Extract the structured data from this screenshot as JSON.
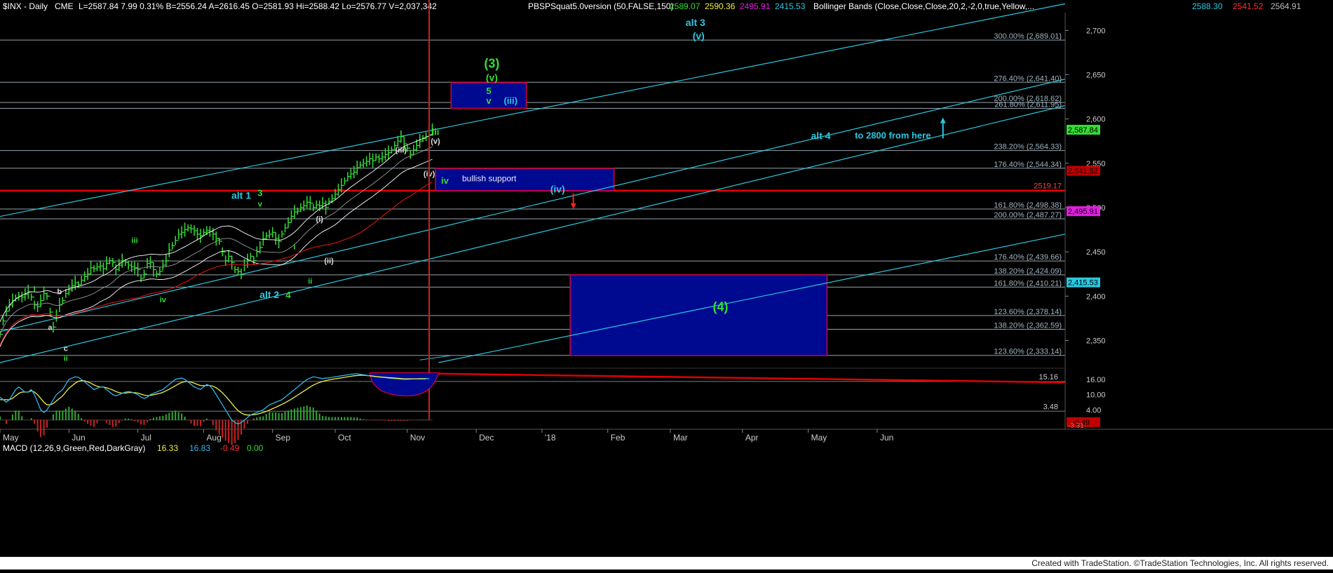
{
  "header": {
    "symbol": "$INX - Daily",
    "exchange": "CME",
    "quote": "L=2587.84  7.99  0.31%  B=2556.24  A=2616.45  O=2581.93  Hi=2588.42  Lo=2576.77  V=2,037,342",
    "study1": "PBSPSquat5.0version (50,FALSE,150)",
    "study1_values": [
      "2589.07",
      "2590.36",
      "2495.91",
      "2415.53"
    ],
    "study2": "Bollinger Bands (Close,Close,Close,20,2,-2,0,true,Yellow,...",
    "study2_values": [
      "2588.30",
      "2541.52",
      "2564.91"
    ]
  },
  "colors": {
    "background": "#000000",
    "grid": "#1a3a4a",
    "price_bar": "#33dd33",
    "channel": "#29c8e0",
    "fib_line": "#c9d8e4",
    "red_line": "#e00000",
    "box_fill": "#000a90",
    "box_border": "#d4004a",
    "label_green": "#33dd33",
    "label_cyan": "#29c8e0",
    "macd": "#2fb5e8",
    "signal": "#f0f040",
    "hist_pos": "#33aa33",
    "hist_neg": "#cc2222"
  },
  "chart_data": [
    {
      "type": "candlestick",
      "x_labels": [
        "May",
        "Jun",
        "Jul",
        "Aug",
        "Sep",
        "Oct",
        "Nov",
        "Dec",
        "'18",
        "Feb",
        "Mar",
        "Apr",
        "May",
        "Jun"
      ],
      "ylim": [
        2325,
        2720
      ],
      "y_ticks": [
        2350,
        2400,
        2450,
        2500,
        2550,
        2600,
        2650,
        2700
      ],
      "y_tick_labels": [
        "2,350",
        "2,400",
        "2,450",
        "2,500",
        "2,550",
        "2,600",
        "2,650",
        "2,700"
      ],
      "price": [
        2357,
        2372,
        2383,
        2390,
        2395,
        2398,
        2400,
        2399,
        2402,
        2405,
        2399,
        2390,
        2388,
        2395,
        2403,
        2400,
        2382,
        2365,
        2378,
        2390,
        2395,
        2403,
        2407,
        2412,
        2415,
        2413,
        2418,
        2422,
        2425,
        2432,
        2431,
        2433,
        2434,
        2431,
        2437,
        2440,
        2438,
        2430,
        2435,
        2440,
        2438,
        2435,
        2433,
        2432,
        2430,
        2420,
        2425,
        2437,
        2438,
        2430,
        2425,
        2428,
        2435,
        2440,
        2452,
        2457,
        2463,
        2470,
        2472,
        2475,
        2477,
        2476,
        2474,
        2470,
        2468,
        2472,
        2474,
        2473,
        2470,
        2465,
        2462,
        2450,
        2440,
        2445,
        2438,
        2430,
        2428,
        2425,
        2435,
        2440,
        2445,
        2440,
        2450,
        2455,
        2465,
        2468,
        2470,
        2472,
        2465,
        2462,
        2470,
        2477,
        2483,
        2490,
        2495,
        2496,
        2500,
        2502,
        2506,
        2505,
        2500,
        2503,
        2502,
        2505,
        2500,
        2507,
        2510,
        2515,
        2520,
        2525,
        2530,
        2535,
        2538,
        2540,
        2545,
        2548,
        2550,
        2552,
        2555,
        2553,
        2557,
        2555,
        2557,
        2560,
        2562,
        2565,
        2570,
        2575,
        2580,
        2572,
        2567,
        2560,
        2565,
        2570,
        2575,
        2578,
        2580,
        2582,
        2588
      ],
      "price_series_name": "",
      "fib_levels": [
        {
          "label": "300.00% (2,689.01)",
          "value": 2689.01
        },
        {
          "label": "276.40% (2,641.40)",
          "value": 2641.4
        },
        {
          "label": "200.00% (2,618.62)",
          "value": 2618.62
        },
        {
          "label": "261.80% (2,611.95)",
          "value": 2611.95
        },
        {
          "label": "238.20% (2,564.33)",
          "value": 2564.33
        },
        {
          "label": "176.40% (2,544.34)",
          "value": 2544.34
        },
        {
          "label": "161.80% (2,498.38)",
          "value": 2498.38
        },
        {
          "label": "200.00% (2,487.27)",
          "value": 2487.27
        },
        {
          "label": "176.40% (2,439.66)",
          "value": 2439.66
        },
        {
          "label": "138.20% (2,424.09)",
          "value": 2424.09
        },
        {
          "label": "161.80% (2,410.21)",
          "value": 2410.21
        },
        {
          "label": "123.60% (2,378.14)",
          "value": 2378.14
        },
        {
          "label": "138.20% (2,362.59)",
          "value": 2362.59
        },
        {
          "label": "123.60% (2,333.14)",
          "value": 2333.14
        }
      ],
      "red_level": {
        "label": "2519.17",
        "value": 2519.17
      },
      "axis_tags": [
        {
          "label": "2,587.84",
          "value": 2587.84,
          "color": "#33dd33",
          "text": "#000"
        },
        {
          "label": "2,541.52",
          "value": 2541.52,
          "color": "#c00000",
          "text": "#000"
        },
        {
          "label": "2,495.91",
          "value": 2495.91,
          "color": "#e020e0",
          "text": "#000"
        },
        {
          "label": "2,415.53",
          "value": 2415.53,
          "color": "#29c8e0",
          "text": "#000"
        }
      ],
      "boxes": [
        {
          "name": "target-box-3",
          "label": "",
          "x0": 144,
          "x1": 168,
          "y0": 2612,
          "y1": 2641
        },
        {
          "name": "bullish-support-box",
          "label": "bullish support",
          "x0": 139,
          "x1": 196,
          "y0": 2519,
          "y1": 2544
        },
        {
          "name": "wave-4-box",
          "label": "",
          "x0": 182,
          "x1": 264,
          "y0": 2333,
          "y1": 2424
        }
      ],
      "annotations": [
        {
          "text": "(3)",
          "x": 157,
          "y": 2658,
          "color": "green",
          "size": 18
        },
        {
          "text": "(v)",
          "x": 157,
          "y": 2643,
          "color": "green",
          "size": 14
        },
        {
          "text": "5",
          "x": 156,
          "y": 2628,
          "color": "green",
          "size": 13
        },
        {
          "text": "v",
          "x": 156,
          "y": 2617,
          "color": "green",
          "size": 13
        },
        {
          "text": "(iii)",
          "x": 163,
          "y": 2617,
          "color": "cyan",
          "size": 13
        },
        {
          "text": "alt 3",
          "x": 222,
          "y": 2705,
          "color": "cyan",
          "size": 14
        },
        {
          "text": "(v)",
          "x": 223,
          "y": 2690,
          "color": "cyan",
          "size": 14
        },
        {
          "text": "iii",
          "x": 139,
          "y": 2582,
          "color": "green",
          "size": 13
        },
        {
          "text": "(v)",
          "x": 139,
          "y": 2572,
          "color": "white",
          "size": 11
        },
        {
          "text": "(iii)",
          "x": 128,
          "y": 2562,
          "color": "white",
          "size": 11
        },
        {
          "text": "(iv)",
          "x": 137,
          "y": 2535,
          "color": "white",
          "size": 11
        },
        {
          "text": "iv",
          "x": 142,
          "y": 2527,
          "color": "green",
          "size": 13
        },
        {
          "text": "(iv)",
          "x": 178,
          "y": 2517,
          "color": "cyan",
          "size": 14
        },
        {
          "text": "alt 4",
          "x": 262,
          "y": 2577,
          "color": "cyan",
          "size": 14
        },
        {
          "text": "to 2800 from here",
          "x": 285,
          "y": 2578,
          "color": "cyan",
          "size": 13
        },
        {
          "text": "alt 1",
          "x": 77,
          "y": 2510,
          "color": "cyan",
          "size": 14
        },
        {
          "text": "3",
          "x": 83,
          "y": 2513,
          "color": "green",
          "size": 13
        },
        {
          "text": "v",
          "x": 83,
          "y": 2501,
          "color": "green",
          "size": 11
        },
        {
          "text": "(i)",
          "x": 102,
          "y": 2484,
          "color": "white",
          "size": 11
        },
        {
          "text": "i",
          "x": 94,
          "y": 2453,
          "color": "green",
          "size": 11
        },
        {
          "text": "(ii)",
          "x": 105,
          "y": 2437,
          "color": "white",
          "size": 11
        },
        {
          "text": "ii",
          "x": 99,
          "y": 2414,
          "color": "green",
          "size": 11
        },
        {
          "text": "alt 2",
          "x": 86,
          "y": 2398,
          "color": "cyan",
          "size": 14
        },
        {
          "text": "4",
          "x": 92,
          "y": 2398,
          "color": "green",
          "size": 13
        },
        {
          "text": "iii",
          "x": 43,
          "y": 2460,
          "color": "green",
          "size": 11
        },
        {
          "text": "iv",
          "x": 52,
          "y": 2393,
          "color": "green",
          "size": 11
        },
        {
          "text": "i",
          "x": 11,
          "y": 2405,
          "color": "green",
          "size": 11
        },
        {
          "text": "b",
          "x": 19,
          "y": 2402,
          "color": "white",
          "size": 11
        },
        {
          "text": "a",
          "x": 16,
          "y": 2362,
          "color": "white",
          "size": 11
        },
        {
          "text": "c",
          "x": 21,
          "y": 2338,
          "color": "white",
          "size": 11
        },
        {
          "text": "ii",
          "x": 21,
          "y": 2327,
          "color": "green",
          "size": 11
        },
        {
          "text": "(4)",
          "x": 230,
          "y": 2383,
          "color": "green",
          "size": 18
        }
      ],
      "channels": [
        {
          "x0": 0,
          "y0": 2490,
          "x1": 340,
          "y1": 2730
        },
        {
          "x0": 0,
          "y0": 2360,
          "x1": 340,
          "y1": 2645
        },
        {
          "x0": 0,
          "y0": 2325,
          "x1": 340,
          "y1": 2615
        },
        {
          "x0": 140,
          "y0": 2325,
          "x1": 340,
          "y1": 2470
        }
      ],
      "arrows": [
        {
          "name": "red-down-arrow",
          "x": 183,
          "y_from": 2516,
          "y_to": 2500,
          "color": "red"
        },
        {
          "name": "cyan-up-arrow",
          "x": 301,
          "y_from": 2578,
          "y_to": 2600,
          "color": "cyan"
        }
      ]
    },
    {
      "type": "macd",
      "title": "MACD (12,26,9,Green,Red,DarkGray)",
      "values_text": [
        "16.33",
        "16.83",
        "-0.49",
        "0.00"
      ],
      "ylim": [
        -2.5,
        19
      ],
      "y_ticks": [
        4,
        10,
        16
      ],
      "y_tick_labels": [
        "4.00",
        "10.00",
        "16.00"
      ],
      "right_tags": [
        {
          "label": "3.48",
          "value": 3.48
        },
        {
          "label": "15.16",
          "value": 15.16
        }
      ],
      "neg_tag": {
        "label": "-0.49",
        "value": 0
      },
      "bottom_tag": "-3.31",
      "macd": [
        9,
        8,
        7,
        8,
        10,
        12,
        13,
        12,
        11,
        11,
        12,
        10,
        7,
        4,
        3,
        4,
        6,
        8,
        10,
        11,
        12,
        14,
        16,
        16.5,
        17,
        16.8,
        16,
        15,
        14,
        13,
        12,
        12.5,
        13,
        13,
        12,
        11,
        10,
        9.5,
        10,
        10.5,
        11,
        11.2,
        11,
        10.5,
        10,
        9,
        8.5,
        9,
        10,
        10.5,
        11,
        11.5,
        12,
        13,
        14,
        15,
        16,
        16.3,
        16.5,
        16,
        15,
        14,
        13,
        12.5,
        12,
        13,
        14,
        13.5,
        12,
        10,
        8,
        6,
        4,
        2,
        0,
        -1,
        -1.5,
        -1,
        0,
        1,
        2,
        2.5,
        3,
        3.5,
        4,
        5,
        6,
        6.5,
        7,
        7.5,
        8,
        9,
        10,
        11,
        12,
        13,
        14,
        15,
        16,
        16.5,
        17,
        16.8,
        16.5,
        16.3,
        16.5,
        16.6,
        16.8,
        17,
        17.2,
        17.4,
        17.6,
        17.8,
        18,
        18.1,
        18.2,
        18,
        17.8,
        17.6,
        17.4,
        17.2,
        17,
        16.9,
        16.8,
        16.7,
        16.5,
        16.4,
        16.3,
        16.2,
        16.1,
        16,
        16,
        16.1,
        16.2,
        16.2,
        16.3,
        16.3,
        16.3,
        16.3
      ],
      "signal": [
        8,
        8,
        8,
        8,
        8.5,
        9.5,
        10.5,
        11,
        11,
        11,
        11.5,
        11,
        10,
        8.5,
        7,
        6,
        6,
        6.5,
        7.5,
        8.5,
        9.5,
        11,
        12.5,
        13.5,
        14.5,
        15.2,
        15.5,
        15.4,
        15,
        14.5,
        13.8,
        13.3,
        13,
        13,
        12.7,
        12.3,
        11.8,
        11.2,
        10.8,
        10.6,
        10.6,
        10.8,
        10.8,
        10.8,
        10.6,
        10.2,
        9.8,
        9.6,
        9.7,
        9.9,
        10.2,
        10.5,
        10.9,
        11.5,
        12.1,
        12.8,
        13.5,
        14.2,
        14.8,
        15.1,
        15.1,
        14.9,
        14.5,
        14,
        13.6,
        13.5,
        13.6,
        13.6,
        13.3,
        12.7,
        11.8,
        10.7,
        9.4,
        8,
        6.5,
        5,
        3.7,
        2.8,
        2.2,
        2,
        2,
        2.1,
        2.3,
        2.6,
        3,
        3.4,
        3.9,
        4.5,
        5,
        5.6,
        6.2,
        6.8,
        7.5,
        8.2,
        9,
        9.8,
        10.6,
        11.4,
        12.2,
        13,
        13.7,
        14.3,
        14.8,
        15.2,
        15.5,
        15.8,
        16,
        16.2,
        16.4,
        16.6,
        16.8,
        17,
        17.2,
        17.4,
        17.5,
        17.6,
        17.6,
        17.5,
        17.4,
        17.3,
        17.1,
        17,
        16.9,
        16.8,
        16.7,
        16.6,
        16.5,
        16.4,
        16.3,
        16.2,
        16.2,
        16.2,
        16.2,
        16.2,
        16.2,
        16.2,
        16.2
      ],
      "histogram_note": ""
    }
  ],
  "footer": {
    "credit": "Created with TradeStation. ©TradeStation Technologies, Inc. All rights reserved."
  }
}
